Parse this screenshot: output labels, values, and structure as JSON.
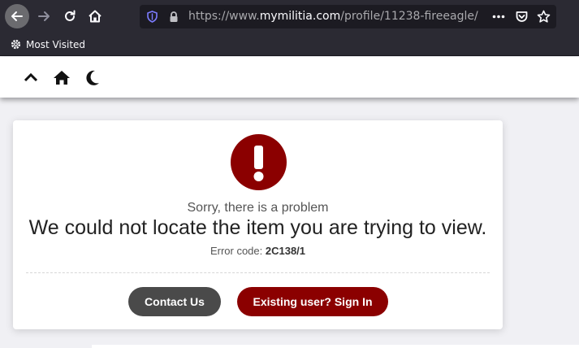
{
  "browser": {
    "url_prefix": "https://www.",
    "url_host": "mymilitia.com",
    "url_path": "/profile/11238-fireeagle/",
    "bookmarks": [
      {
        "label": "Most Visited"
      }
    ]
  },
  "error": {
    "subtitle": "Sorry, there is a problem",
    "message": "We could not locate the item you are trying to view.",
    "code_label": "Error code: ",
    "code": "2C138/1",
    "icon": "exclamation-icon",
    "accent_color": "#8b0000"
  },
  "actions": {
    "contact_label": "Contact Us",
    "signin_label": "Existing user? Sign In"
  },
  "header_icons": [
    "chevron-up-icon",
    "home-icon",
    "moon-icon"
  ]
}
